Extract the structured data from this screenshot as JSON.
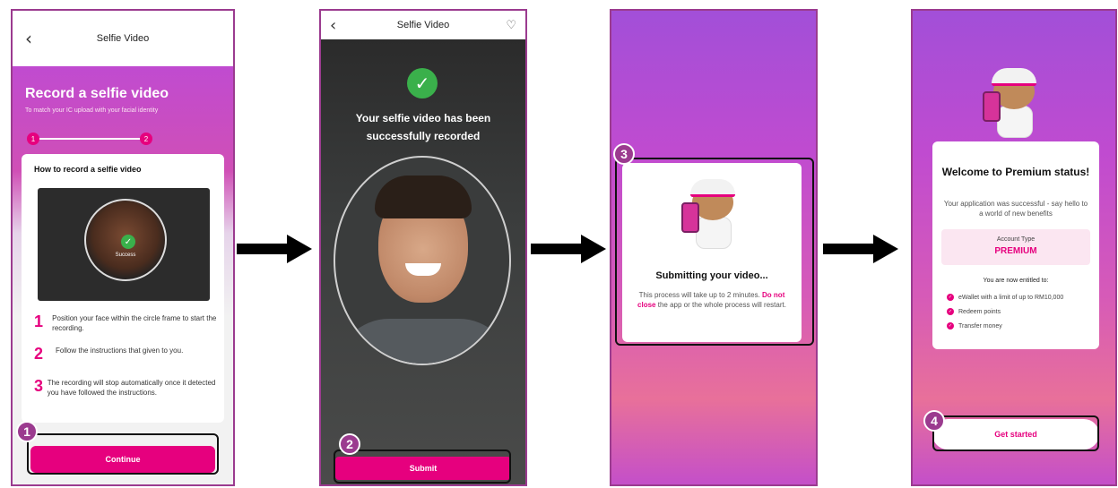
{
  "step1": {
    "header_title": "Selfie Video",
    "title": "Record a selfie video",
    "subtitle": "To match your IC upload with your facial identity",
    "stepper": [
      "1",
      "2"
    ],
    "card_title": "How to record a selfie video",
    "success_label": "Success",
    "instructions": [
      {
        "num": "1",
        "text": "Position your face within the circle frame to start the recording."
      },
      {
        "num": "2",
        "text": "Follow the instructions that given to you."
      },
      {
        "num": "3",
        "text": "The recording will stop automatically once it detected you have followed the instructions."
      }
    ],
    "continue_label": "Continue",
    "badge": "1"
  },
  "step2": {
    "header_title": "Selfie Video",
    "message": "Your selfie video has been successfully recorded",
    "submit_label": "Submit",
    "badge": "2"
  },
  "step3": {
    "title": "Submitting your video...",
    "desc_pre": "This process will take up to 2 minutes.",
    "desc_bold": "Do not close",
    "desc_post": "the app or the whole process will restart.",
    "badge": "3"
  },
  "step4": {
    "title": "Welcome to Premium status!",
    "subtitle": "Your application was successful - say hello to a world of new benefits",
    "account_type_label": "Account Type",
    "account_type_value": "PREMIUM",
    "entitled_label": "You are now entitled to:",
    "benefits": [
      "eWallet with a limit of up to RM10,000",
      "Redeem points",
      "Transfer money"
    ],
    "get_started_label": "Get started",
    "badge": "4"
  },
  "colors": {
    "brand_pink": "#e6007e",
    "callout_purple": "#9b3b8f",
    "success_green": "#3ab04b"
  },
  "icons": [
    "back-chevron-icon",
    "check-icon",
    "heart-shield-icon",
    "arrow-right-icon"
  ]
}
